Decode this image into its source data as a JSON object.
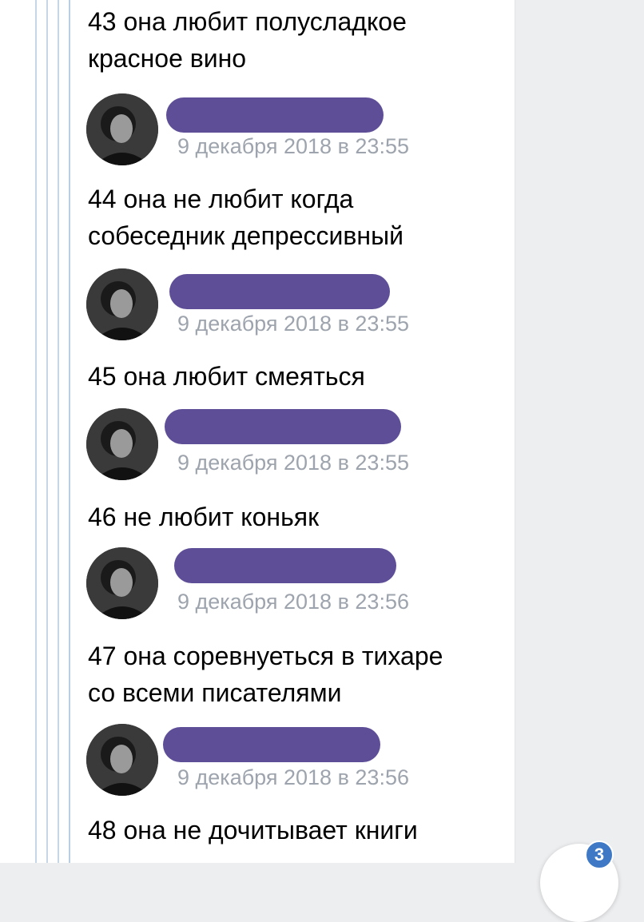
{
  "messages": [
    {
      "text": "43 она любит полусладкое\nкрасное вино"
    },
    {
      "text": "44 она не любит когда\nсобеседник депрессивный"
    },
    {
      "text": "45 она любит смеяться"
    },
    {
      "text": "46 не любит коньяк"
    },
    {
      "text": "47 она соревнуеться в тихаре\nсо всеми писателями"
    },
    {
      "text": "48 она не дочитывает книги"
    }
  ],
  "timestamps": [
    "9 декабря 2018 в 23:55",
    "9 декабря 2018 в 23:55",
    "9 декабря 2018 в 23:55",
    "9 декабря 2018 в 23:56",
    "9 декабря 2018 в 23:56"
  ],
  "fab": {
    "badge": "3"
  },
  "colors": {
    "redaction": "#5e4e97",
    "thread_line": "#b9cde3",
    "timestamp": "#9ea4ad",
    "badge": "#3f79c6"
  }
}
